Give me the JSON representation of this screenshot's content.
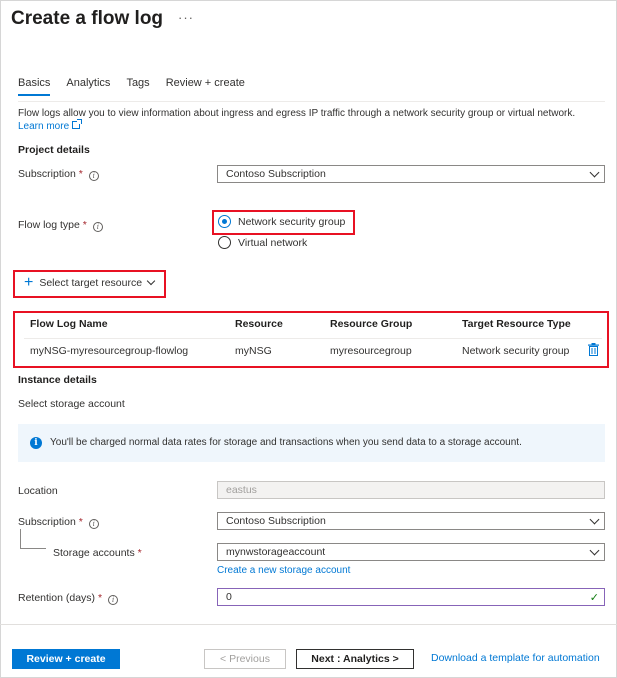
{
  "header": {
    "title": "Create a flow log",
    "more": "···"
  },
  "tabs": [
    {
      "label": "Basics"
    },
    {
      "label": "Analytics"
    },
    {
      "label": "Tags"
    },
    {
      "label": "Review + create"
    }
  ],
  "intro": {
    "description": "Flow logs allow you to view information about ingress and egress IP traffic through a network security group or virtual network.",
    "learn_more": "Learn more"
  },
  "project": {
    "heading": "Project details",
    "subscription_label": "Subscription",
    "subscription_value": "Contoso Subscription",
    "flow_log_type_label": "Flow log type",
    "radio_options": [
      "Network security group",
      "Virtual network"
    ],
    "selected_option": "Network security group",
    "select_target": "Select target resource"
  },
  "grid": {
    "headers": [
      "Flow Log Name",
      "Resource",
      "Resource Group",
      "Target Resource Type"
    ],
    "rows": [
      [
        "myNSG-myresourcegroup-flowlog",
        "myNSG",
        "myresourcegroup",
        "Network security group"
      ]
    ]
  },
  "instance": {
    "heading": "Instance details",
    "storage_subheading": "Select storage account",
    "info_text": "You'll be charged normal data rates for storage and transactions when you send data to a storage account.",
    "location_label": "Location",
    "location_value": "eastus",
    "subscription_label": "Subscription",
    "subscription_value": "Contoso Subscription",
    "storage_label": "Storage accounts",
    "storage_value": "mynwstorageaccount",
    "create_storage_link": "Create a new storage account",
    "retention_label": "Retention (days)",
    "retention_value": "0"
  },
  "footer": {
    "review_create": "Review + create",
    "previous": "< Previous",
    "next": "Next : Analytics >",
    "download_template": "Download a template for automation"
  },
  "colors": {
    "accent": "#0078d4",
    "highlight": "#e81123",
    "required": "#a4262c"
  },
  "icons": {
    "info": "info-icon",
    "trash": "trash-icon",
    "chevron": "chevron-down-icon",
    "external": "external-link-icon",
    "check": "check-icon",
    "plus": "plus-icon"
  }
}
